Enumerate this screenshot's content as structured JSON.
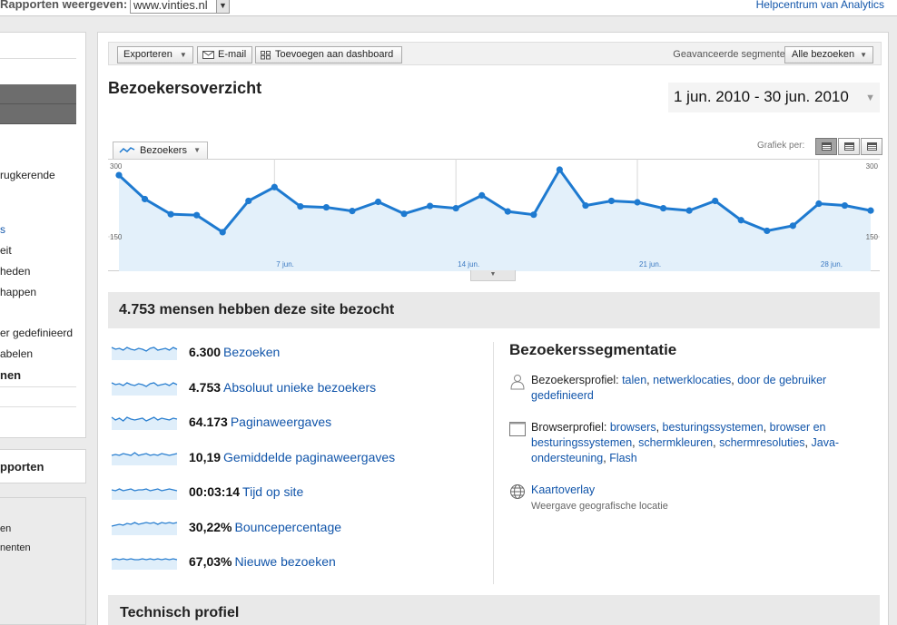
{
  "topbar": {
    "report_label": "Rapporten weergeven:",
    "site": "www.vinties.nl",
    "help": "Helpcentrum van Analytics"
  },
  "sidebar": {
    "items": [
      "rugkerende",
      "s",
      "eit",
      "heden",
      "happen",
      "er gedefinieerd",
      "abelen",
      "nen"
    ],
    "reports_label": "pporten",
    "bottom_items": [
      "en",
      "nenten"
    ]
  },
  "toolbar": {
    "export_label": "Exporteren",
    "email_label": "E-mail",
    "dashboard_label": "Toevoegen aan dashboard",
    "segments_label": "Geavanceerde segmenten:",
    "segment_value": "Alle bezoeken"
  },
  "page": {
    "title": "Bezoekersoverzicht",
    "date_range": "1 jun. 2010 - 30 jun. 2010"
  },
  "chart": {
    "metric": "Bezoekers",
    "graph_by_label": "Grafiek per:"
  },
  "chart_data": {
    "type": "area",
    "series": [
      {
        "name": "Bezoekers",
        "values": [
          284,
          232,
          199,
          197,
          160,
          228,
          258,
          216,
          214,
          206,
          226,
          200,
          217,
          212,
          240,
          205,
          198,
          296,
          218,
          228,
          225,
          212,
          207,
          228,
          186,
          163,
          174,
          222,
          218,
          207
        ]
      }
    ],
    "x": [
      1,
      2,
      3,
      4,
      5,
      6,
      7,
      8,
      9,
      10,
      11,
      12,
      13,
      14,
      15,
      16,
      17,
      18,
      19,
      20,
      21,
      22,
      23,
      24,
      25,
      26,
      27,
      28,
      29,
      30
    ],
    "xtick_labels": [
      {
        "day": 7,
        "label": "7 jun."
      },
      {
        "day": 14,
        "label": "14 jun."
      },
      {
        "day": 21,
        "label": "21 jun."
      },
      {
        "day": 28,
        "label": "28 jun."
      }
    ],
    "ytick_labels": [
      "300",
      "150"
    ],
    "ylim": [
      75,
      300
    ],
    "grid": true,
    "color": "#1e7ad0",
    "fill_color": "#e3f0fa"
  },
  "summary": {
    "headline": "4.753 mensen hebben deze site bezocht"
  },
  "metrics": [
    {
      "value": "6.300",
      "label": "Bezoeken"
    },
    {
      "value": "4.753",
      "label": "Absoluut unieke bezoekers"
    },
    {
      "value": "64.173",
      "label": "Paginaweergaves"
    },
    {
      "value": "10,19",
      "label": "Gemiddelde paginaweergaves"
    },
    {
      "value": "00:03:14",
      "label": "Tijd op site"
    },
    {
      "value": "30,22%",
      "label": "Bouncepercentage"
    },
    {
      "value": "67,03%",
      "label": "Nieuwe bezoeken"
    }
  ],
  "segmentation": {
    "title": "Bezoekerssegmentatie",
    "visitor_profile": {
      "label": "Bezoekersprofiel:",
      "links": [
        "talen",
        "netwerklocaties",
        "door de gebruiker gedefinieerd"
      ]
    },
    "browser_profile": {
      "label": "Browserprofiel:",
      "links": [
        "browsers",
        "besturingssystemen",
        "browser en besturingssystemen",
        "schermkleuren",
        "schermresoluties",
        "Java-ondersteuning",
        "Flash"
      ]
    },
    "map_overlay": {
      "label": "Kaartoverlay",
      "sub": "Weergave geografische locatie"
    }
  },
  "technical": {
    "title": "Technisch profiel"
  }
}
